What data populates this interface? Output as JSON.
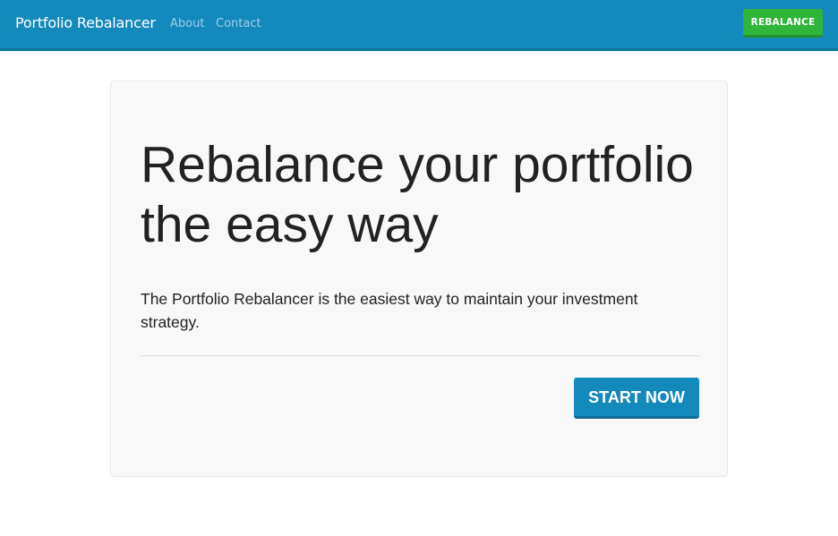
{
  "navbar": {
    "brand": "Portfolio Rebalancer",
    "links": [
      {
        "label": "About"
      },
      {
        "label": "Contact"
      }
    ],
    "rebalance_label": "REBALANCE"
  },
  "hero": {
    "headline": "Rebalance your portfolio the easy way",
    "lead": "The Portfolio Rebalancer is the easiest way to maintain your investment strategy.",
    "cta_label": "START NOW"
  },
  "colors": {
    "navbar_bg": "#1489bc",
    "primary_button": "#1489bc",
    "success_button": "#2fb53a",
    "jumbotron_bg": "#f8f8f8",
    "text": "#222222"
  }
}
